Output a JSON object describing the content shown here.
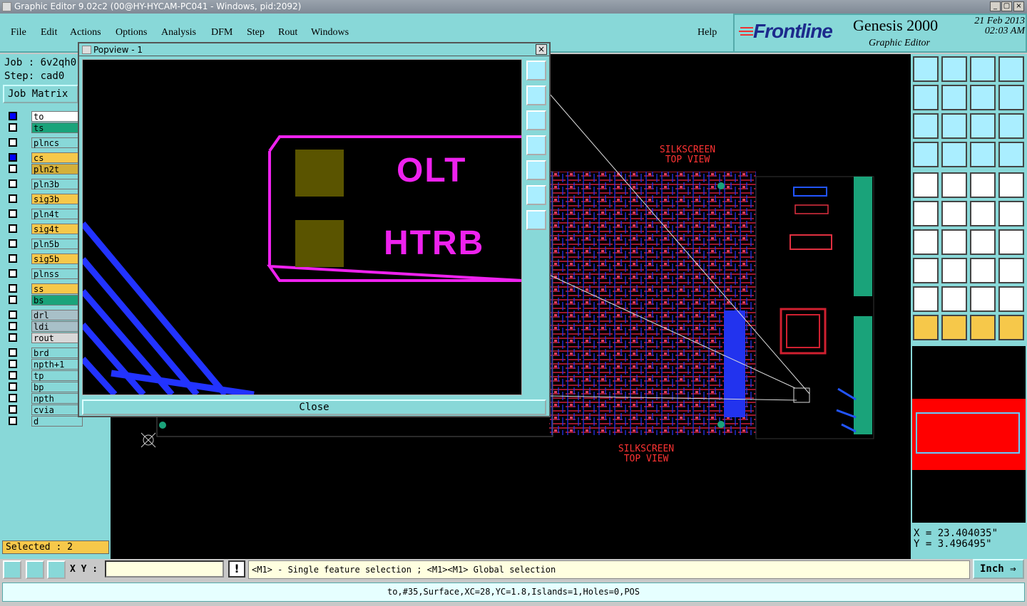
{
  "window": {
    "title": "Graphic Editor 9.02c2 (00@HY-HYCAM-PC041 - Windows, pid:2092)"
  },
  "menu": {
    "items": [
      "File",
      "Edit",
      "Actions",
      "Options",
      "Analysis",
      "DFM",
      "Step",
      "Rout",
      "Windows"
    ],
    "help": "Help"
  },
  "brand": {
    "logo": "Frontline",
    "product": "Genesis 2000",
    "subtitle": "Graphic Editor",
    "date": "21 Feb 2013",
    "time": "02:03 AM"
  },
  "job": {
    "job_label": "Job : 6v2qh0",
    "step_label": "Step: cad0",
    "matrix_button": "Job Matrix"
  },
  "layers": [
    {
      "name": "to",
      "color": "#ffffff",
      "on": true
    },
    {
      "name": "ts",
      "color": "#1aa37a",
      "on": false
    },
    {
      "name": "plncs",
      "color": "#88d8d8",
      "on": false
    },
    {
      "name": "cs",
      "color": "#f6c84a",
      "on": true
    },
    {
      "name": "pln2t",
      "color": "#d4b03a",
      "on": false
    },
    {
      "name": "pln3b",
      "color": "#88d8d8",
      "on": false
    },
    {
      "name": "sig3b",
      "color": "#f6c84a",
      "on": false
    },
    {
      "name": "pln4t",
      "color": "#88d8d8",
      "on": false
    },
    {
      "name": "sig4t",
      "color": "#f6c84a",
      "on": false
    },
    {
      "name": "pln5b",
      "color": "#88d8d8",
      "on": false
    },
    {
      "name": "sig5b",
      "color": "#f6c84a",
      "on": false
    },
    {
      "name": "plnss",
      "color": "#88d8d8",
      "on": false
    },
    {
      "name": "ss",
      "color": "#f6c84a",
      "on": false
    },
    {
      "name": "bs",
      "color": "#1aa37a",
      "on": false
    },
    {
      "name": "drl",
      "color": "#a8c0c8",
      "on": false
    },
    {
      "name": "ldi",
      "color": "#a8c0c8",
      "on": false
    },
    {
      "name": "rout",
      "color": "#d8d8d8",
      "on": false
    },
    {
      "name": "brd",
      "color": "#88d8d8",
      "on": false
    },
    {
      "name": "npth+1",
      "color": "#88d8d8",
      "on": false
    },
    {
      "name": "tp",
      "color": "#88d8d8",
      "on": false
    },
    {
      "name": "bp",
      "color": "#88d8d8",
      "on": false
    },
    {
      "name": "npth",
      "color": "#88d8d8",
      "on": false
    },
    {
      "name": "cvia",
      "color": "#88d8d8",
      "on": false
    },
    {
      "name": "d",
      "color": "#88d8d8",
      "on": false
    }
  ],
  "selected": "Selected : 2",
  "popview": {
    "title": "Popview - 1",
    "text1": "OLT",
    "text2": "HTRB",
    "close_label": "Close"
  },
  "canvas": {
    "annotation_top": "SILKSCREEN\nTOP VIEW",
    "annotation_bottom": "SILKSCREEN\nTOP VIEW"
  },
  "coords": {
    "x": "X = 23.404035\"",
    "y": "Y = 3.496495\""
  },
  "bottom": {
    "xy_label": "X Y :",
    "xy_value": "",
    "message": "<M1> - Single feature selection ; <M1><M1> Global selection",
    "units": "Inch",
    "status": "to,#35,Surface,XC=28,YC=1.8,Islands=1,Holes=0,POS"
  },
  "tools_right": [
    "home-icon",
    "down-icon",
    "house-icon",
    "split-icon",
    "left-icon",
    "right-icon",
    "swap-icon",
    "redraw-icon",
    "zoom-fit-icon",
    "center-icon",
    "ratio-icon",
    "help-icon",
    "measure-icon",
    "grid-icon",
    "snap-icon",
    "snap-red-icon",
    "pen-icon",
    "rect-icon",
    "ruler-icon",
    "dashed-box-icon",
    "net-icon",
    "x-icon",
    "line-icon",
    "line-red-icon",
    "angle-icon",
    "slash-icon",
    "arc-icon",
    "pad-icon",
    "node-icon",
    "bar-icon",
    "dimension-icon",
    "circle-icon",
    "tri-icon",
    "tri2-icon",
    "arch-icon",
    "arch2-icon",
    "select-icon",
    "select2-icon",
    "select3-icon",
    "route-icon"
  ]
}
